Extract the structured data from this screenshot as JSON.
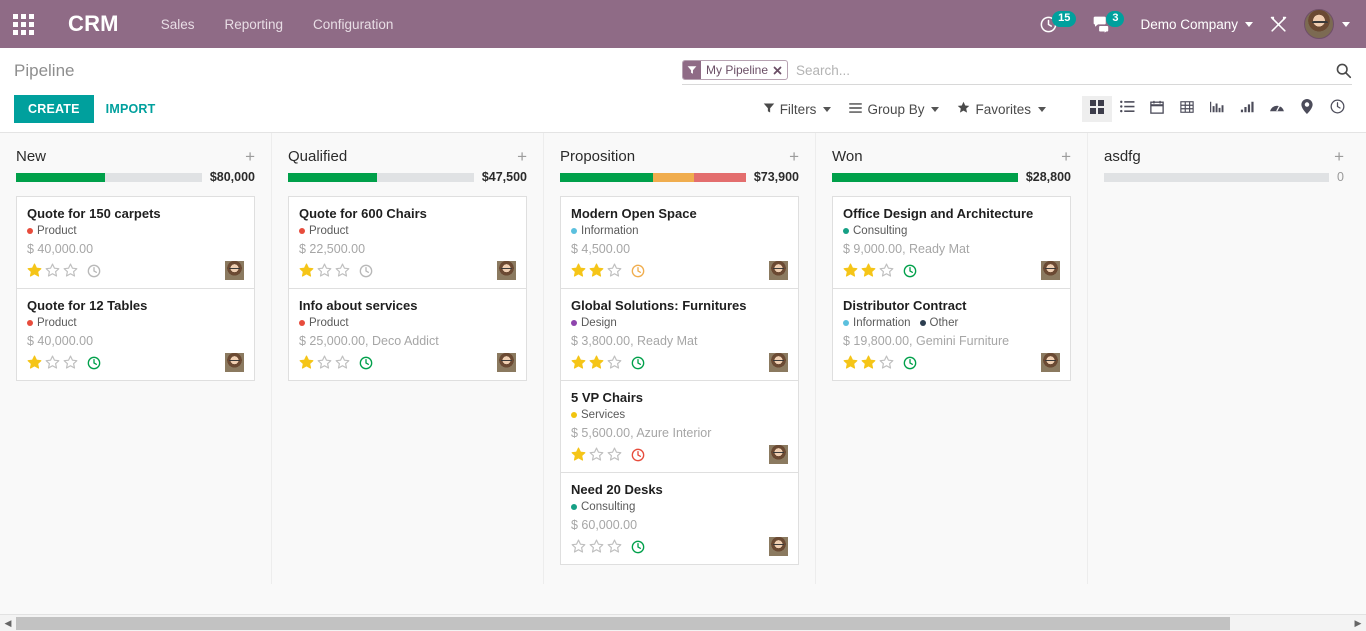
{
  "navbar": {
    "apps_icon": "grid-apps-icon",
    "brand": "CRM",
    "menus": [
      {
        "label": "Sales"
      },
      {
        "label": "Reporting"
      },
      {
        "label": "Configuration"
      }
    ],
    "activities_icon": "clock-activity-icon",
    "activities_count": "15",
    "messages_icon": "chat-bubble-icon",
    "messages_count": "3",
    "company": "Demo Company",
    "debug_icon": "crossed-tools-icon",
    "avatar_icon": "user-avatar"
  },
  "control_panel": {
    "title": "Pipeline",
    "create_label": "CREATE",
    "import_label": "IMPORT",
    "search": {
      "facet_icon": "filter-funnel-icon",
      "facet_label": "My Pipeline",
      "facet_remove_icon": "close-x-icon",
      "placeholder": "Search...",
      "value": "",
      "magnifier_icon": "search-icon"
    },
    "dropdowns": [
      {
        "label": "Filters",
        "icon": "filter-funnel-icon"
      },
      {
        "label": "Group By",
        "icon": "hamburger-lines-icon"
      },
      {
        "label": "Favorites",
        "icon": "star-icon"
      }
    ],
    "views": [
      {
        "name": "kanban-view-button",
        "icon": "kanban-squares-icon",
        "active": true
      },
      {
        "name": "list-view-button",
        "icon": "list-icon",
        "active": false
      },
      {
        "name": "calendar-view-button",
        "icon": "calendar-icon",
        "active": false
      },
      {
        "name": "pivot-view-button",
        "icon": "table-grid-icon",
        "active": false
      },
      {
        "name": "graph-bar-view-button",
        "icon": "bar-chart-icon",
        "active": false
      },
      {
        "name": "graph-line-view-button",
        "icon": "ascending-bars-icon",
        "active": false
      },
      {
        "name": "cohort-view-button",
        "icon": "dashboard-gauge-icon",
        "active": false
      },
      {
        "name": "map-view-button",
        "icon": "map-pin-icon",
        "active": false
      },
      {
        "name": "activity-view-button",
        "icon": "clock-icon",
        "active": false
      }
    ]
  },
  "colors": {
    "brand_purple": "#8f6b86",
    "accent_teal": "#00a09d",
    "progress_green": "#00a04a",
    "progress_orange": "#f0ad4e",
    "progress_red": "#e36e6e",
    "star_gold": "#f5c518"
  },
  "kanban": {
    "columns": [
      {
        "title": "New",
        "add_icon": "plus-icon",
        "amount": "$80,000",
        "amount_muted": false,
        "progress": [
          {
            "color": "#00a04a",
            "pct": 48
          }
        ],
        "cards": [
          {
            "title": "Quote for 150 carpets",
            "tags": [
              {
                "label": "Product",
                "color": "#e74c3c"
              }
            ],
            "amount": "$ 40,000.00",
            "stars": 1,
            "stars_total": 3,
            "clock": "gray",
            "avatar_icon": "user-avatar"
          },
          {
            "title": "Quote for 12 Tables",
            "tags": [
              {
                "label": "Product",
                "color": "#e74c3c"
              }
            ],
            "amount": "$ 40,000.00",
            "stars": 1,
            "stars_total": 3,
            "clock": "green",
            "avatar_icon": "user-avatar"
          }
        ]
      },
      {
        "title": "Qualified",
        "add_icon": "plus-icon",
        "amount": "$47,500",
        "amount_muted": false,
        "progress": [
          {
            "color": "#00a04a",
            "pct": 48
          }
        ],
        "cards": [
          {
            "title": "Quote for 600 Chairs",
            "tags": [
              {
                "label": "Product",
                "color": "#e74c3c"
              }
            ],
            "amount": "$ 22,500.00",
            "stars": 1,
            "stars_total": 3,
            "clock": "gray",
            "avatar_icon": "user-avatar"
          },
          {
            "title": "Info about services",
            "tags": [
              {
                "label": "Product",
                "color": "#e74c3c"
              }
            ],
            "amount": "$ 25,000.00, Deco Addict",
            "stars": 1,
            "stars_total": 3,
            "clock": "green",
            "avatar_icon": "user-avatar"
          }
        ]
      },
      {
        "title": "Proposition",
        "add_icon": "plus-icon",
        "amount": "$73,900",
        "amount_muted": false,
        "progress": [
          {
            "color": "#00a04a",
            "pct": 50
          },
          {
            "color": "#f0ad4e",
            "pct": 22
          },
          {
            "color": "#e36e6e",
            "pct": 28
          }
        ],
        "cards": [
          {
            "title": "Modern Open Space",
            "tags": [
              {
                "label": "Information",
                "color": "#5bc0de"
              }
            ],
            "amount": "$ 4,500.00",
            "stars": 2,
            "stars_total": 3,
            "clock": "orange",
            "avatar_icon": "user-avatar"
          },
          {
            "title": "Global Solutions: Furnitures",
            "tags": [
              {
                "label": "Design",
                "color": "#8e44ad"
              }
            ],
            "amount": "$ 3,800.00, Ready Mat",
            "stars": 2,
            "stars_total": 3,
            "clock": "green",
            "avatar_icon": "user-avatar"
          },
          {
            "title": "5 VP Chairs",
            "tags": [
              {
                "label": "Services",
                "color": "#f1c40f"
              }
            ],
            "amount": "$ 5,600.00, Azure Interior",
            "stars": 1,
            "stars_total": 3,
            "clock": "red",
            "avatar_icon": "user-avatar"
          },
          {
            "title": "Need 20 Desks",
            "tags": [
              {
                "label": "Consulting",
                "color": "#16a085"
              }
            ],
            "amount": "$ 60,000.00",
            "stars": 0,
            "stars_total": 3,
            "clock": "green",
            "avatar_icon": "user-avatar"
          }
        ]
      },
      {
        "title": "Won",
        "add_icon": "plus-icon",
        "amount": "$28,800",
        "amount_muted": false,
        "progress": [
          {
            "color": "#00a04a",
            "pct": 100
          }
        ],
        "cards": [
          {
            "title": "Office Design and Architecture",
            "tags": [
              {
                "label": "Consulting",
                "color": "#16a085"
              }
            ],
            "amount": "$ 9,000.00, Ready Mat",
            "stars": 2,
            "stars_total": 3,
            "clock": "green",
            "avatar_icon": "user-avatar"
          },
          {
            "title": "Distributor Contract",
            "tags": [
              {
                "label": "Information",
                "color": "#5bc0de"
              },
              {
                "label": "Other",
                "color": "#2c3e50"
              }
            ],
            "amount": "$ 19,800.00, Gemini Furniture",
            "stars": 2,
            "stars_total": 3,
            "clock": "green",
            "avatar_icon": "user-avatar"
          }
        ]
      },
      {
        "title": "asdfg",
        "add_icon": "plus-icon",
        "amount": "0",
        "amount_muted": true,
        "progress": [],
        "cards": []
      }
    ]
  },
  "scrollbar": {
    "left_arrow_icon": "chevron-left-icon",
    "right_arrow_icon": "chevron-right-icon",
    "thumb_pct": 91
  }
}
